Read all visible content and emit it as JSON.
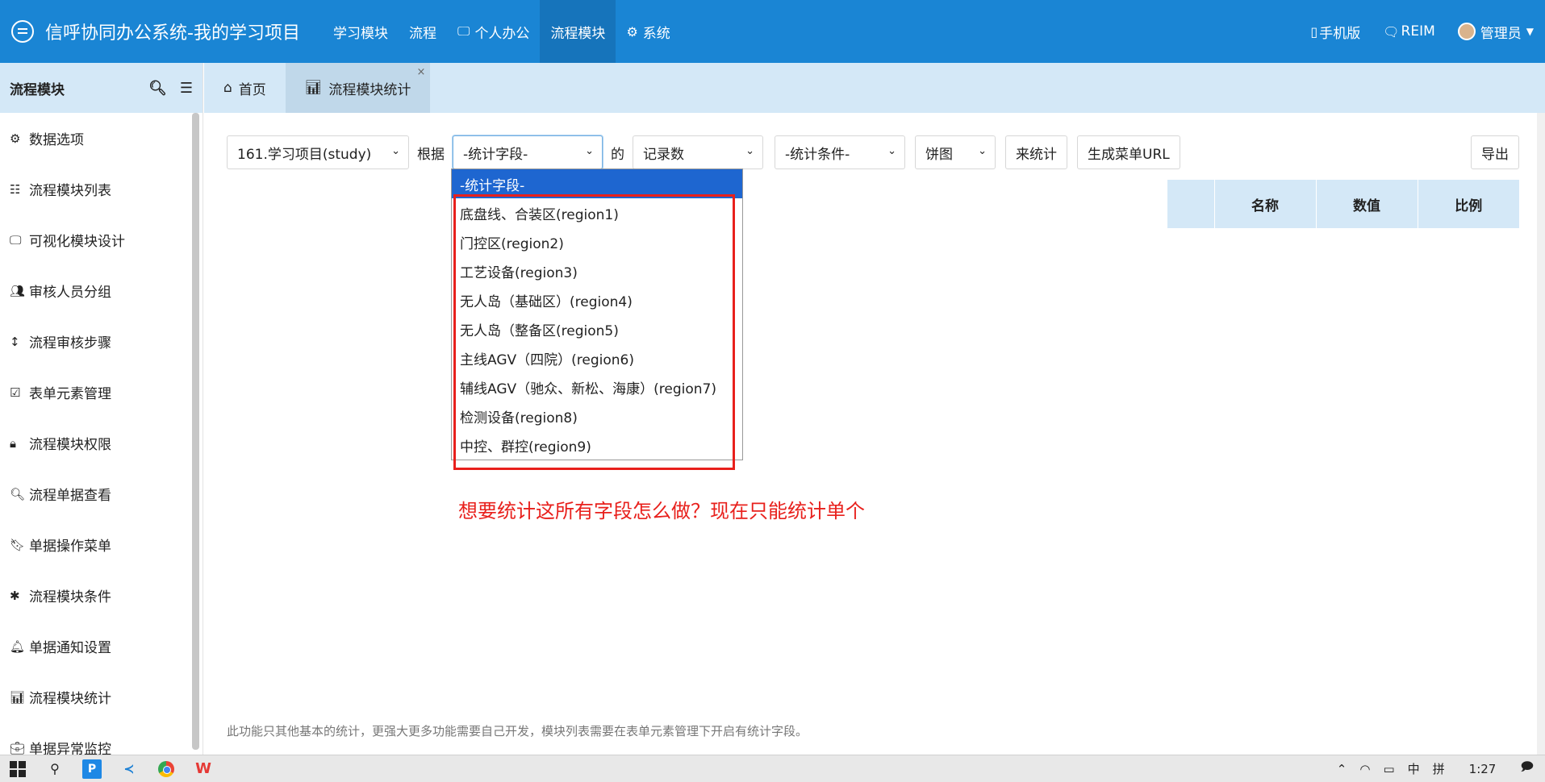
{
  "header": {
    "app_title": "信呼协同办公系统-我的学习项目",
    "nav": [
      {
        "label": "学习模块",
        "icon": ""
      },
      {
        "label": "流程",
        "icon": ""
      },
      {
        "label": "个人办公",
        "icon": "monitor-icon"
      },
      {
        "label": "流程模块",
        "icon": "",
        "active": true
      },
      {
        "label": "系统",
        "icon": "gear-icon"
      }
    ],
    "right": {
      "mobile": "手机版",
      "reim": "REIM",
      "user": "管理员"
    }
  },
  "sidebar": {
    "title": "流程模块",
    "items": [
      {
        "label": "数据选项",
        "icon": "gear-icon"
      },
      {
        "label": "流程模块列表",
        "icon": "list-icon"
      },
      {
        "label": "可视化模块设计",
        "icon": "monitor-icon"
      },
      {
        "label": "审核人员分组",
        "icon": "users-icon"
      },
      {
        "label": "流程审核步骤",
        "icon": "vertical-arrows-icon"
      },
      {
        "label": "表单元素管理",
        "icon": "check-square-icon"
      },
      {
        "label": "流程模块权限",
        "icon": "lock-icon"
      },
      {
        "label": "流程单据查看",
        "icon": "search-icon"
      },
      {
        "label": "单据操作菜单",
        "icon": "bookmark-icon"
      },
      {
        "label": "流程模块条件",
        "icon": "asterisk-icon"
      },
      {
        "label": "单据通知设置",
        "icon": "bell-icon"
      },
      {
        "label": "流程模块统计",
        "icon": "bar-chart-icon"
      },
      {
        "label": "单据异常监控",
        "icon": "briefcase-icon"
      }
    ]
  },
  "tabs": [
    {
      "label": "首页",
      "icon": "home-icon"
    },
    {
      "label": "流程模块统计",
      "icon": "bar-chart-icon",
      "active": true,
      "close": "×"
    }
  ],
  "toolbar": {
    "module_select": "161.学习项目(study)",
    "by_label": "根据",
    "field_select": "-统计字段-",
    "of_label": "的",
    "metric_select": "记录数",
    "condition_select": "-统计条件-",
    "chart_select": "饼图",
    "stat_button": "来统计",
    "url_button": "生成菜单URL",
    "export_button": "导出"
  },
  "result_table": {
    "columns": [
      "",
      "名称",
      "数值",
      "比例"
    ]
  },
  "field_dropdown": {
    "options": [
      "-统计字段-",
      "底盘线、合装区(region1)",
      "门控区(region2)",
      "工艺设备(region3)",
      "无人岛（基础区）(region4)",
      "无人岛（整备区(region5)",
      "主线AGV（四院）(region6)",
      "辅线AGV（驰众、新松、海康）(region7)",
      "检测设备(region8)",
      "中控、群控(region9)"
    ],
    "selected_index": 0
  },
  "annotation": "想要统计这所有字段怎么做？现在只能统计单个",
  "footnote": "此功能只其他基本的统计，更强大更多功能需要自己开发，模块列表需要在表单元素管理下开启有统计字段。",
  "taskbar": {
    "time": "1:27",
    "ime_lang": "中",
    "ime_mode": "拼"
  },
  "colors": {
    "header_bg": "#1a85d4",
    "header_active": "#1674bb",
    "panel_bg": "#d4e8f7",
    "dropdown_selected": "#1e66d0",
    "annotation_red": "#e8201c"
  }
}
